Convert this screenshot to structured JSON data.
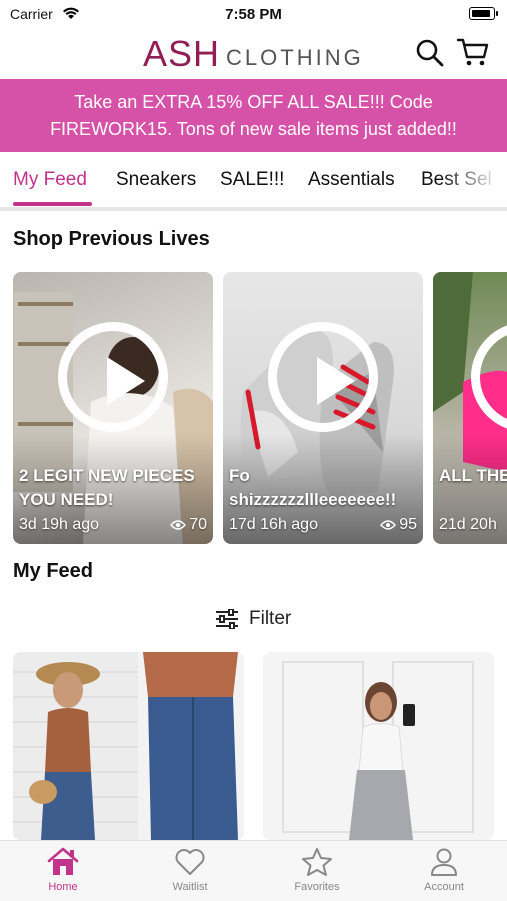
{
  "status_bar": {
    "carrier": "Carrier",
    "time": "7:58 PM"
  },
  "header": {
    "logo_main": "ASH",
    "logo_sub": "CLOTHING"
  },
  "banner": {
    "text": "Take an EXTRA 15% OFF ALL SALE!!! Code FIREWORK15. Tons of new sale items just added!!"
  },
  "tabs": [
    {
      "label": "My Feed"
    },
    {
      "label": "Sneakers"
    },
    {
      "label": "SALE!!!"
    },
    {
      "label": "Assentials"
    },
    {
      "label": "Best Sel"
    }
  ],
  "previous_lives": {
    "heading": "Shop Previous Lives",
    "items": [
      {
        "title": "2 LEGIT NEW PIECES YOU NEED!",
        "ago": "3d 19h ago",
        "views": "70"
      },
      {
        "title": "Fo shizzzzzzllleeeeeee!!",
        "ago": "17d 16h ago",
        "views": "95"
      },
      {
        "title": "ALL THE SNEAKE",
        "ago": "21d 20h",
        "views": ""
      }
    ]
  },
  "feed": {
    "heading": "My Feed",
    "filter_label": "Filter"
  },
  "tabbar": [
    {
      "label": "Home",
      "icon": "home-icon"
    },
    {
      "label": "Waitlist",
      "icon": "heart-icon"
    },
    {
      "label": "Favorites",
      "icon": "star-icon"
    },
    {
      "label": "Account",
      "icon": "person-icon"
    }
  ],
  "colors": {
    "brand": "#8f1f55",
    "accent": "#c2338c",
    "banner": "#d651a8"
  }
}
